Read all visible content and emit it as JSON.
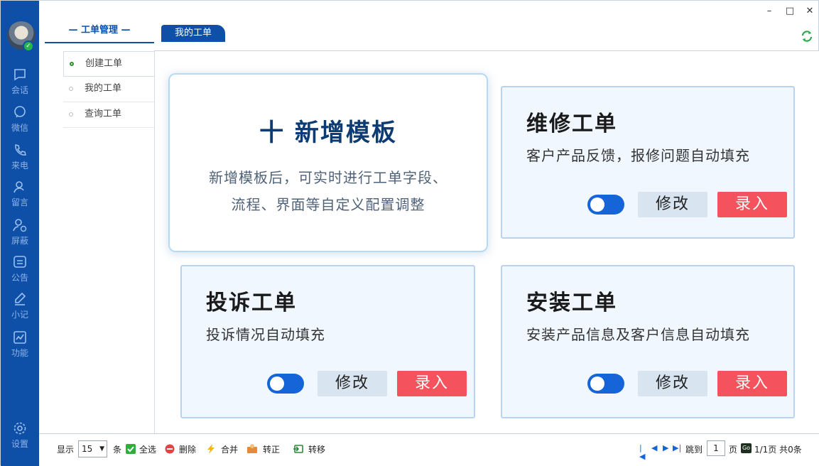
{
  "rail": {
    "items": [
      {
        "label": "会话",
        "icon": "chat-bubble-icon"
      },
      {
        "label": "微信",
        "icon": "wechat-icon"
      },
      {
        "label": "来电",
        "icon": "phone-icon"
      },
      {
        "label": "留言",
        "icon": "message-user-icon"
      },
      {
        "label": "屏蔽",
        "icon": "block-user-icon"
      },
      {
        "label": "公告",
        "icon": "announcement-icon"
      },
      {
        "label": "小记",
        "icon": "pen-icon"
      },
      {
        "label": "功能",
        "icon": "chart-icon"
      }
    ],
    "settings_label": "设置"
  },
  "header": {
    "module_title": "— 工单管理 —",
    "active_tab": "我的工单"
  },
  "sidebar": {
    "items": [
      {
        "label": "创建工单",
        "active": true
      },
      {
        "label": "我的工单",
        "active": false
      },
      {
        "label": "查询工单",
        "active": false
      }
    ]
  },
  "new_template": {
    "title": "十 新增模板",
    "desc_line1": "新增模板后，可实时进行工单字段、",
    "desc_line2": "流程、界面等自定义配置调整"
  },
  "cards": [
    {
      "title": "维修工单",
      "desc": "客户产品反馈，报修问题自动填充",
      "enabled": true,
      "edit_label": "修改",
      "enter_label": "录入"
    },
    {
      "title": "投诉工单",
      "desc": "投诉情况自动填充",
      "enabled": true,
      "edit_label": "修改",
      "enter_label": "录入"
    },
    {
      "title": "安装工单",
      "desc": "安装产品信息及客户信息自动填充",
      "enabled": true,
      "edit_label": "修改",
      "enter_label": "录入"
    }
  ],
  "footer": {
    "show_label": "显示",
    "page_size": "15",
    "unit_label": "条",
    "select_all": "全选",
    "delete": "删除",
    "merge": "合并",
    "convert": "转正",
    "transfer": "转移",
    "jump_label": "跳到",
    "page_input": "1",
    "page_label": "页",
    "go_label": "Go",
    "summary": "1/1页 共0条"
  },
  "colors": {
    "rail_bg": "#0e4fa8",
    "accent": "#1565d8",
    "enter_button": "#f4525c",
    "card_bg": "#f0f7ff"
  }
}
